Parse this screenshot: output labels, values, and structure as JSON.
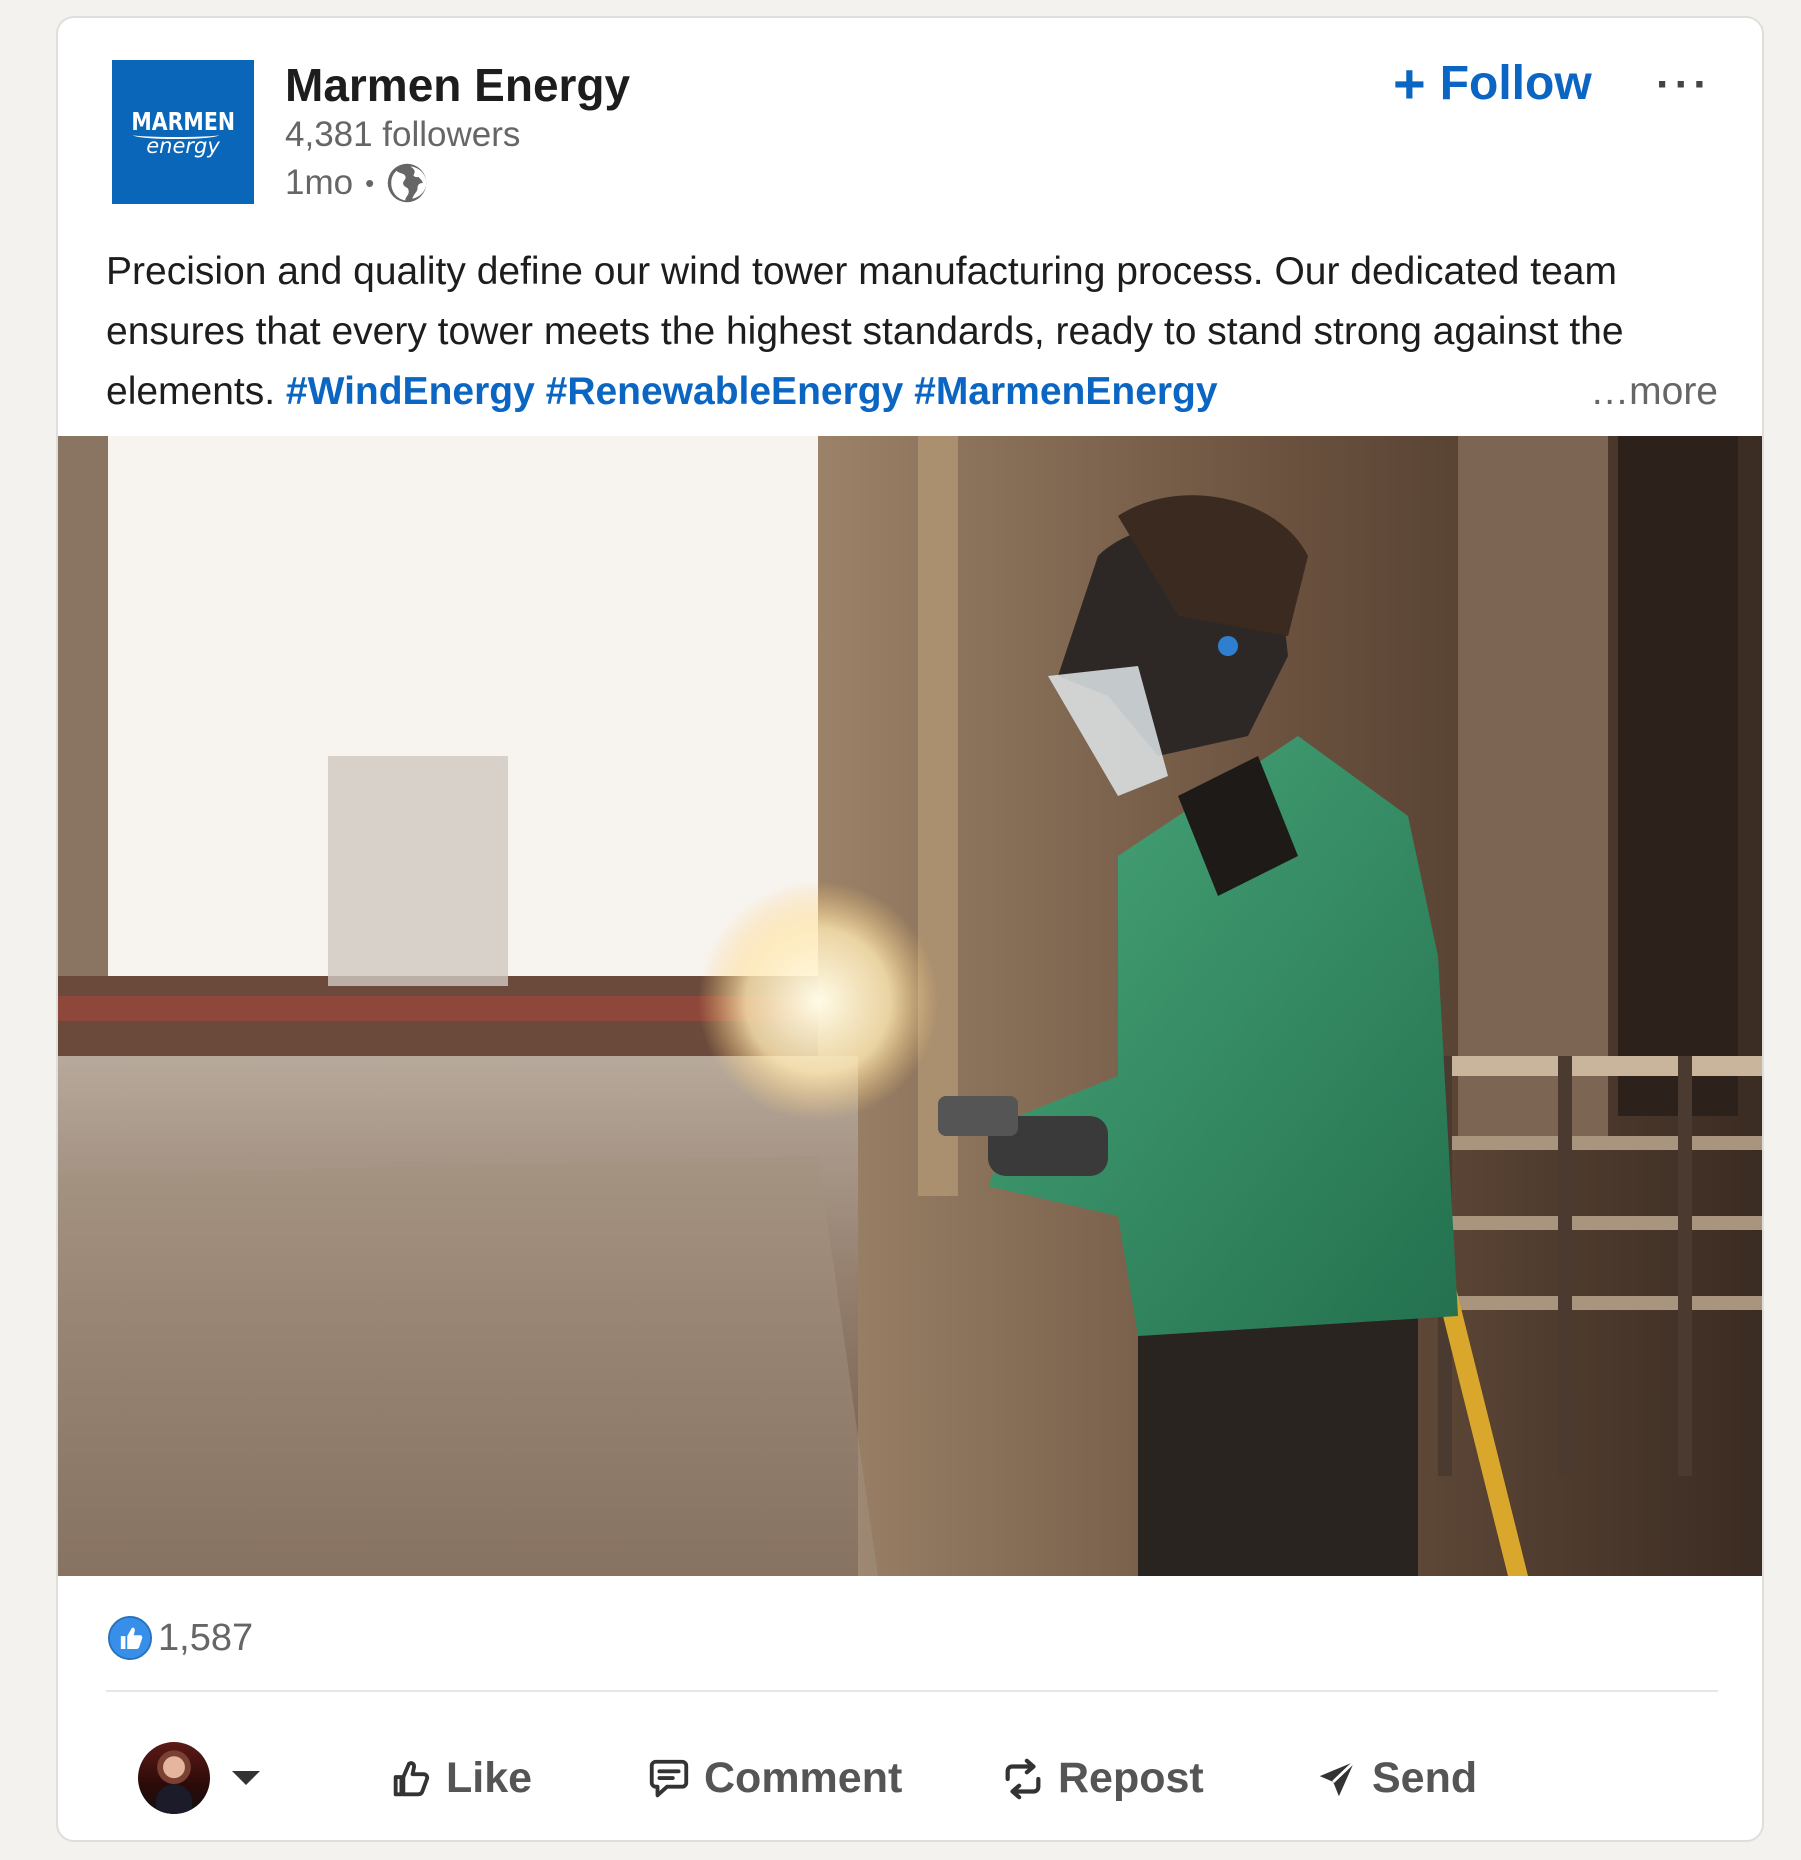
{
  "author": {
    "logo_top": "MARMEN",
    "logo_bottom": "energy",
    "name": "Marmen Energy",
    "followers": "4,381 followers",
    "time": "1mo",
    "separator": "•",
    "visibility_icon": "globe-icon"
  },
  "header_actions": {
    "follow_plus": "+",
    "follow_label": "Follow",
    "more_label": "···"
  },
  "post": {
    "text": "Precision and quality define our wind tower manufacturing process. Our dedicated team ensures that every tower meets the highest standards, ready to stand strong against the elements. ",
    "hashtags": [
      "#WindEnergy",
      "#RenewableEnergy",
      "#MarmenEnergy"
    ],
    "see_more": "…more",
    "image_subject": "worker in green jacket and face shield grinding steel with sparks in a factory"
  },
  "social": {
    "reaction_icon": "like-reaction-icon",
    "reaction_count": "1,587"
  },
  "actions": {
    "like": "Like",
    "comment": "Comment",
    "repost": "Repost",
    "send": "Send"
  },
  "colors": {
    "brand_blue": "#0a66c2",
    "logo_blue": "#0a66b8",
    "text": "#1d1d1d",
    "muted": "#666666",
    "background": "#f3f2ef"
  }
}
